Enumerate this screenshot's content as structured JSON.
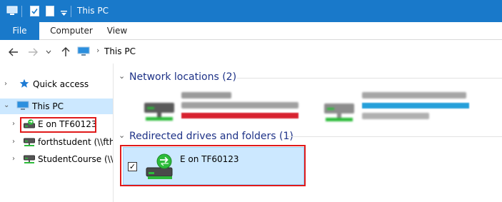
{
  "window": {
    "title": "This PC"
  },
  "ribbon": {
    "tabs": [
      {
        "label": "File"
      },
      {
        "label": "Computer"
      },
      {
        "label": "View"
      }
    ]
  },
  "address": {
    "location": "This PC"
  },
  "navpane": {
    "items": [
      {
        "label": "Quick access",
        "icon": "star-icon"
      },
      {
        "label": "This PC",
        "icon": "computer-icon"
      },
      {
        "label": "E on TF60123",
        "icon": "redirected-drive-icon"
      },
      {
        "label": "forthstudent (\\\\fthf",
        "icon": "network-drive-icon"
      },
      {
        "label": "StudentCourse (\\\\ft",
        "icon": "network-drive-icon"
      }
    ]
  },
  "main": {
    "network_group": {
      "header": "Network locations (2)"
    },
    "redirected_group": {
      "header": "Redirected drives and folders (1)"
    },
    "redirected_drive": {
      "label": "E on TF60123",
      "checked": "✓"
    }
  },
  "colors": {
    "accent": "#1979ca",
    "selection": "#cce8ff",
    "highlight_box": "#e01a1a",
    "usage_red": "#d82230",
    "usage_blue": "#26a0da"
  }
}
